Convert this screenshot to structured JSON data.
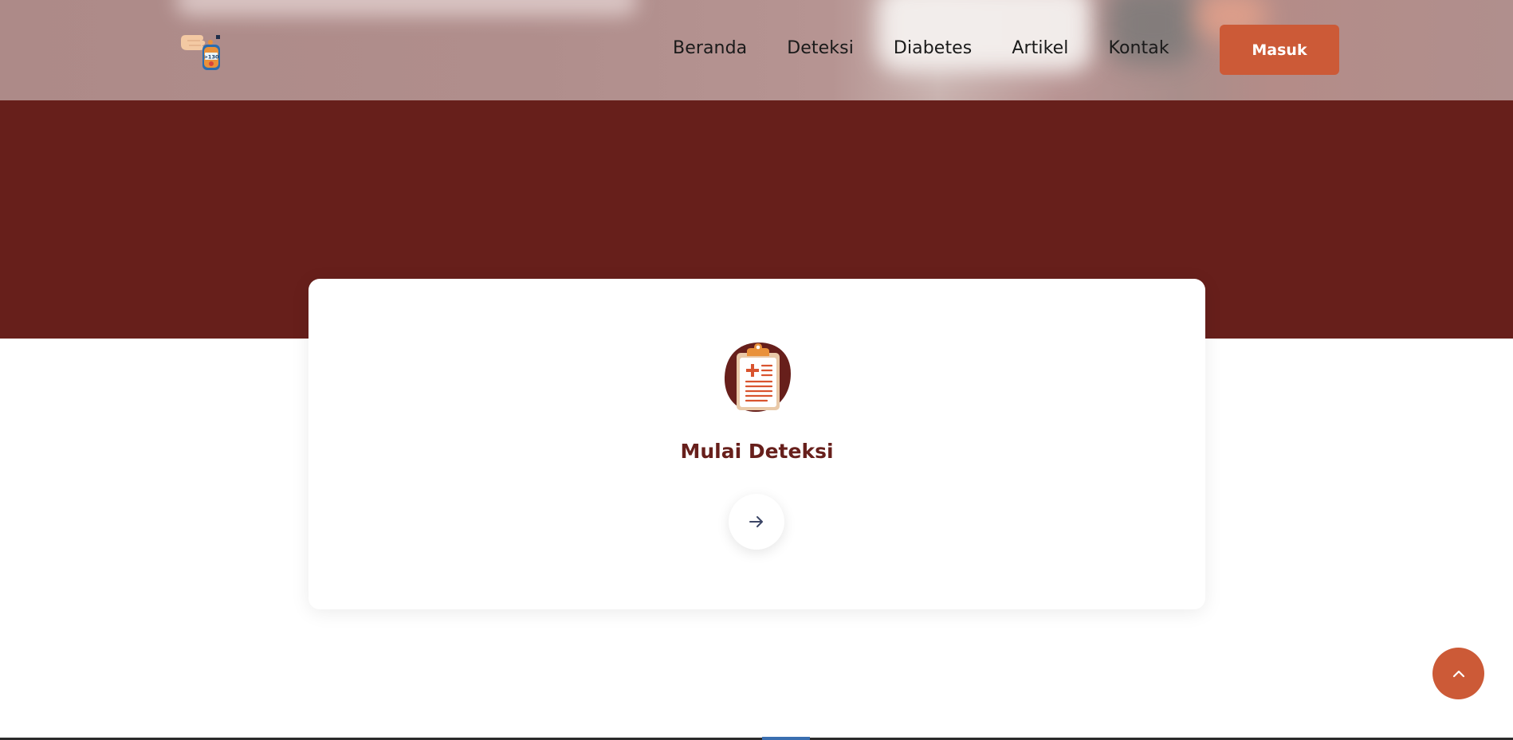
{
  "nav": {
    "logo_alt": "glucometer-logo",
    "items": [
      {
        "label": "Beranda"
      },
      {
        "label": "Deteksi"
      },
      {
        "label": "Diabetes"
      },
      {
        "label": "Artikel"
      },
      {
        "label": "Kontak"
      }
    ],
    "login_label": "Masuk"
  },
  "card": {
    "icon": "clipboard-medical-icon",
    "title": "Mulai Deteksi",
    "action_icon": "arrow-right-icon"
  },
  "floating": {
    "icon": "chevron-up-icon"
  },
  "colors": {
    "brand_maroon": "#671f1b",
    "accent_orange": "#cc5a37",
    "text_dark": "#1a1a1a"
  }
}
